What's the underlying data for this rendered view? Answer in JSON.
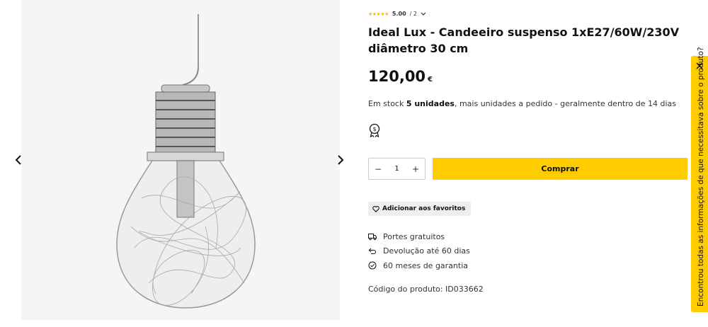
{
  "gallery": {
    "prev_icon": "chevron-left-icon",
    "next_icon": "chevron-right-icon"
  },
  "rating": {
    "stars": "★★★★★",
    "score": "5.00",
    "count": "/ 2"
  },
  "product": {
    "title": "Ideal Lux - Candeeiro suspenso 1xE27/60W/230V diâmetro 30 cm",
    "price": "120,00",
    "currency": "€",
    "stock_prefix": "Em stock ",
    "stock_qty": "5 unidades",
    "stock_suffix": ", mais unidades a pedido - geralmente dentro de 14 dias",
    "code": "Código do produto: ID033662"
  },
  "cart": {
    "minus": "−",
    "quantity": "1",
    "plus": "+",
    "buy_label": "Comprar"
  },
  "favorites": {
    "label": "Adicionar aos favoritos"
  },
  "perks": [
    {
      "icon": "truck-icon",
      "label": "Portes gratuitos"
    },
    {
      "icon": "return-icon",
      "label": "Devolução até 60 dias"
    },
    {
      "icon": "check-circle-icon",
      "label": "60 meses de garantia"
    }
  ],
  "feedback": {
    "label": "Encontrou todas as informações de que necessitava sobre o produto?"
  },
  "colors": {
    "accent": "#ffcc00",
    "stars": "#f5c000",
    "gallery_bg": "#f5f5f5"
  }
}
